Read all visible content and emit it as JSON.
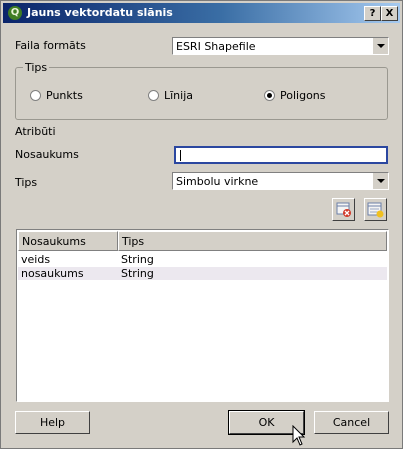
{
  "window": {
    "title": "Jauns vektordatu slānis",
    "help_glyph": "?",
    "close_glyph": "X"
  },
  "file_format": {
    "label": "Faila formāts",
    "value": "ESRI Shapefile"
  },
  "type_group": {
    "legend": "Tips",
    "options": [
      {
        "label": "Punkts",
        "checked": false
      },
      {
        "label": "Līnija",
        "checked": false
      },
      {
        "label": "Poligons",
        "checked": true
      }
    ]
  },
  "attributes": {
    "section_label": "Atribūti",
    "name_label": "Nosaukums",
    "name_value": "",
    "type_label": "Tips",
    "type_value": "Simbolu virkne"
  },
  "table": {
    "headers": [
      "Nosaukums",
      "Tips"
    ],
    "rows": [
      [
        "veids",
        "String"
      ],
      [
        "nosaukums",
        "String"
      ]
    ]
  },
  "buttons": {
    "help": "Help",
    "ok": "OK",
    "cancel": "Cancel"
  }
}
